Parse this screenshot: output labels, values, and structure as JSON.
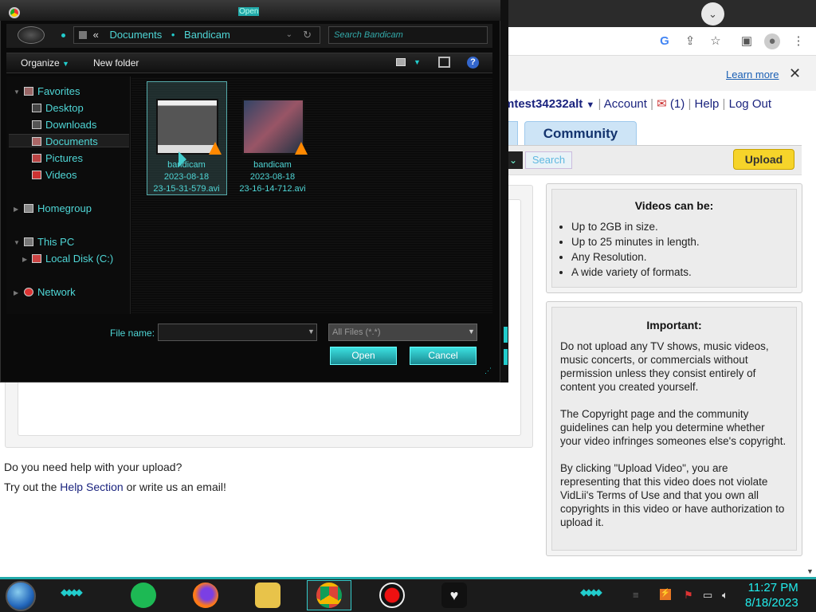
{
  "dialog": {
    "title": "Open",
    "breadcrumb": {
      "chevron": "«",
      "crumbs": [
        "Documents",
        "Bandicam"
      ]
    },
    "search_placeholder": "Search Bandicam",
    "organize": "Organize",
    "new_folder": "New folder",
    "nav": {
      "favorites": "Favorites",
      "desktop": "Desktop",
      "downloads": "Downloads",
      "documents": "Documents",
      "pictures": "Pictures",
      "videos": "Videos",
      "homegroup": "Homegroup",
      "this_pc": "This PC",
      "local_disk": "Local Disk (C:)",
      "network": "Network"
    },
    "files": [
      {
        "line1": "bandicam",
        "line2": "2023-08-18",
        "line3": "23-15-31-579.avi"
      },
      {
        "line1": "bandicam",
        "line2": "2023-08-18",
        "line3": "23-16-14-712.avi"
      }
    ],
    "file_name_label": "File name:",
    "file_name_value": "",
    "file_type": "All Files (*.*)",
    "open_label": "Open",
    "cancel_label": "Cancel"
  },
  "browser": {
    "learn_more": "Learn more",
    "close": "✕"
  },
  "vidlii": {
    "username": "mtest34232alt",
    "account": "Account",
    "messages": "(1)",
    "help": "Help",
    "logout": "Log Out",
    "community_tab": "Community",
    "search_label": "Search",
    "upload_label": "Upload",
    "videos_can_be": {
      "title": "Videos can be:",
      "items": [
        "Up to 2GB in size.",
        "Up to 25 minutes in length.",
        "Any Resolution.",
        "A wide variety of formats."
      ]
    },
    "important": {
      "title": "Important:",
      "p1": "Do not upload any TV shows, music videos, music concerts, or commercials without permission unless they consist entirely of content you created yourself.",
      "p2": "The Copyright page and the community guidelines can help you determine whether your video infringes someones else's copyright.",
      "p3": "By clicking \"Upload Video\", you are representing that this video does not violate VidLii's Terms of Use and that you own all copyrights in this video or have authorization to upload it."
    },
    "help_question": "Do you need help with your upload?",
    "help_prefix": "Try out the",
    "help_link": "Help Section",
    "help_suffix": "or write us an email!"
  },
  "taskbar": {
    "time": "11:27 PM",
    "date": "8/18/2023"
  },
  "colors": {
    "accent": "#2cc",
    "dialog_text": "#4fd6d6",
    "vidlii_link": "#1a237e",
    "upload_yellow": "#f6d42a"
  }
}
